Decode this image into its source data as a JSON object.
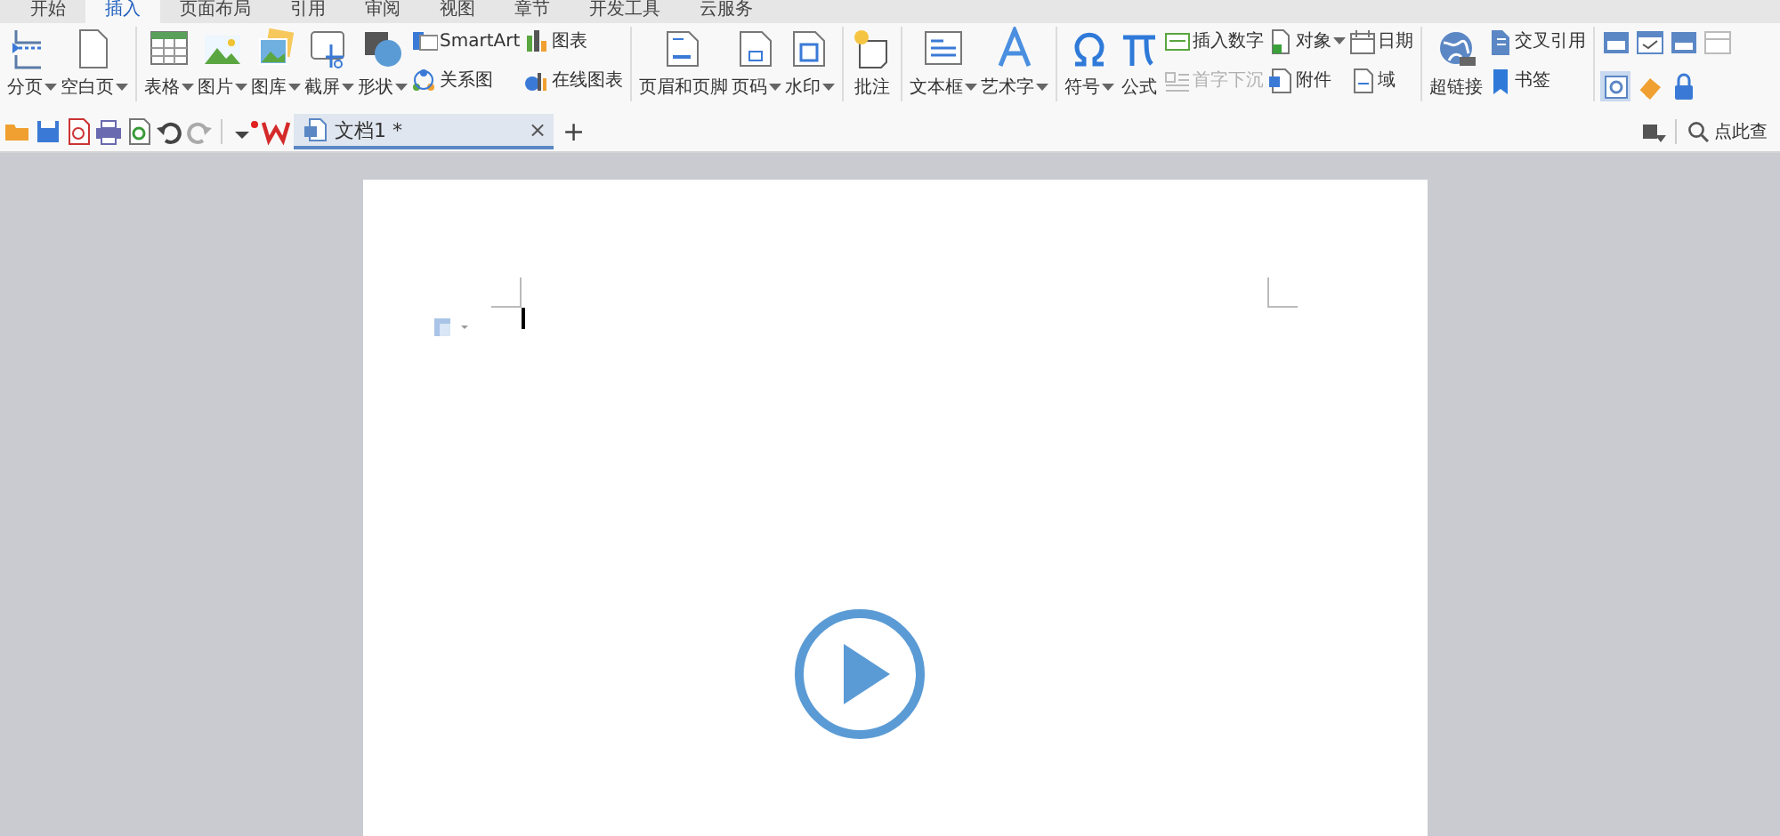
{
  "menu_tabs": [
    {
      "label": "开始",
      "selected": false
    },
    {
      "label": "插入",
      "selected": true
    },
    {
      "label": "页面布局",
      "selected": false
    },
    {
      "label": "引用",
      "selected": false
    },
    {
      "label": "审阅",
      "selected": false
    },
    {
      "label": "视图",
      "selected": false
    },
    {
      "label": "章节",
      "selected": false
    },
    {
      "label": "开发工具",
      "selected": false
    },
    {
      "label": "云服务",
      "selected": false
    }
  ],
  "ribbon": {
    "groups": [
      {
        "items": [
          {
            "kind": "large",
            "label": "分页",
            "dropdown": true
          },
          {
            "kind": "large",
            "label": "空白页",
            "dropdown": true
          }
        ]
      },
      {
        "items": [
          {
            "kind": "large",
            "label": "表格",
            "dropdown": true
          },
          {
            "kind": "large",
            "label": "图片",
            "dropdown": true
          },
          {
            "kind": "large",
            "label": "图库",
            "dropdown": true
          },
          {
            "kind": "large",
            "label": "截屏",
            "dropdown": true
          },
          {
            "kind": "large",
            "label": "形状",
            "dropdown": true
          },
          {
            "kind": "stack",
            "items": [
              {
                "label": "SmartArt",
                "dropdown": false,
                "disabled": false
              },
              {
                "label": "关系图",
                "dropdown": false,
                "disabled": false
              }
            ]
          },
          {
            "kind": "stack",
            "items": [
              {
                "label": "图表",
                "dropdown": false,
                "disabled": false
              },
              {
                "label": "在线图表",
                "dropdown": false,
                "disabled": false
              }
            ]
          }
        ]
      },
      {
        "items": [
          {
            "kind": "large",
            "label": "页眉和页脚",
            "dropdown": false
          },
          {
            "kind": "large",
            "label": "页码",
            "dropdown": true
          },
          {
            "kind": "large",
            "label": "水印",
            "dropdown": true
          }
        ]
      },
      {
        "items": [
          {
            "kind": "large",
            "label": "批注",
            "dropdown": false
          }
        ]
      },
      {
        "items": [
          {
            "kind": "large",
            "label": "文本框",
            "dropdown": true
          },
          {
            "kind": "large",
            "label": "艺术字",
            "dropdown": true
          }
        ]
      },
      {
        "items": [
          {
            "kind": "large",
            "label": "符号",
            "dropdown": true
          },
          {
            "kind": "large",
            "label": "公式",
            "dropdown": false
          },
          {
            "kind": "stack",
            "items": [
              {
                "label": "插入数字",
                "dropdown": false,
                "disabled": false
              },
              {
                "label": "首字下沉",
                "dropdown": false,
                "disabled": true
              }
            ]
          },
          {
            "kind": "stack",
            "items": [
              {
                "label": "对象",
                "dropdown": true,
                "disabled": false
              },
              {
                "label": "附件",
                "dropdown": false,
                "disabled": false
              }
            ]
          },
          {
            "kind": "stack",
            "items": [
              {
                "label": "日期",
                "dropdown": false,
                "disabled": false
              },
              {
                "label": "域",
                "dropdown": false,
                "disabled": false
              }
            ]
          }
        ]
      },
      {
        "items": [
          {
            "kind": "large",
            "label": "超链接",
            "dropdown": false
          },
          {
            "kind": "stack",
            "items": [
              {
                "label": "交叉引用",
                "dropdown": false,
                "disabled": false
              },
              {
                "label": "书签",
                "dropdown": false,
                "disabled": false
              }
            ]
          }
        ]
      },
      {
        "items": [
          {
            "kind": "icons",
            "items": [
              {
                "selected": false
              },
              {
                "selected": false
              },
              {
                "selected": false
              },
              {
                "selected": false
              },
              {
                "selected": true
              },
              {
                "selected": false
              },
              {
                "selected": false
              }
            ]
          }
        ]
      }
    ]
  },
  "doc_tabs": [
    {
      "label": "文档1 *",
      "close": "×",
      "selected": true
    }
  ],
  "new_tab": "+",
  "search": {
    "placeholder": "点此查"
  }
}
